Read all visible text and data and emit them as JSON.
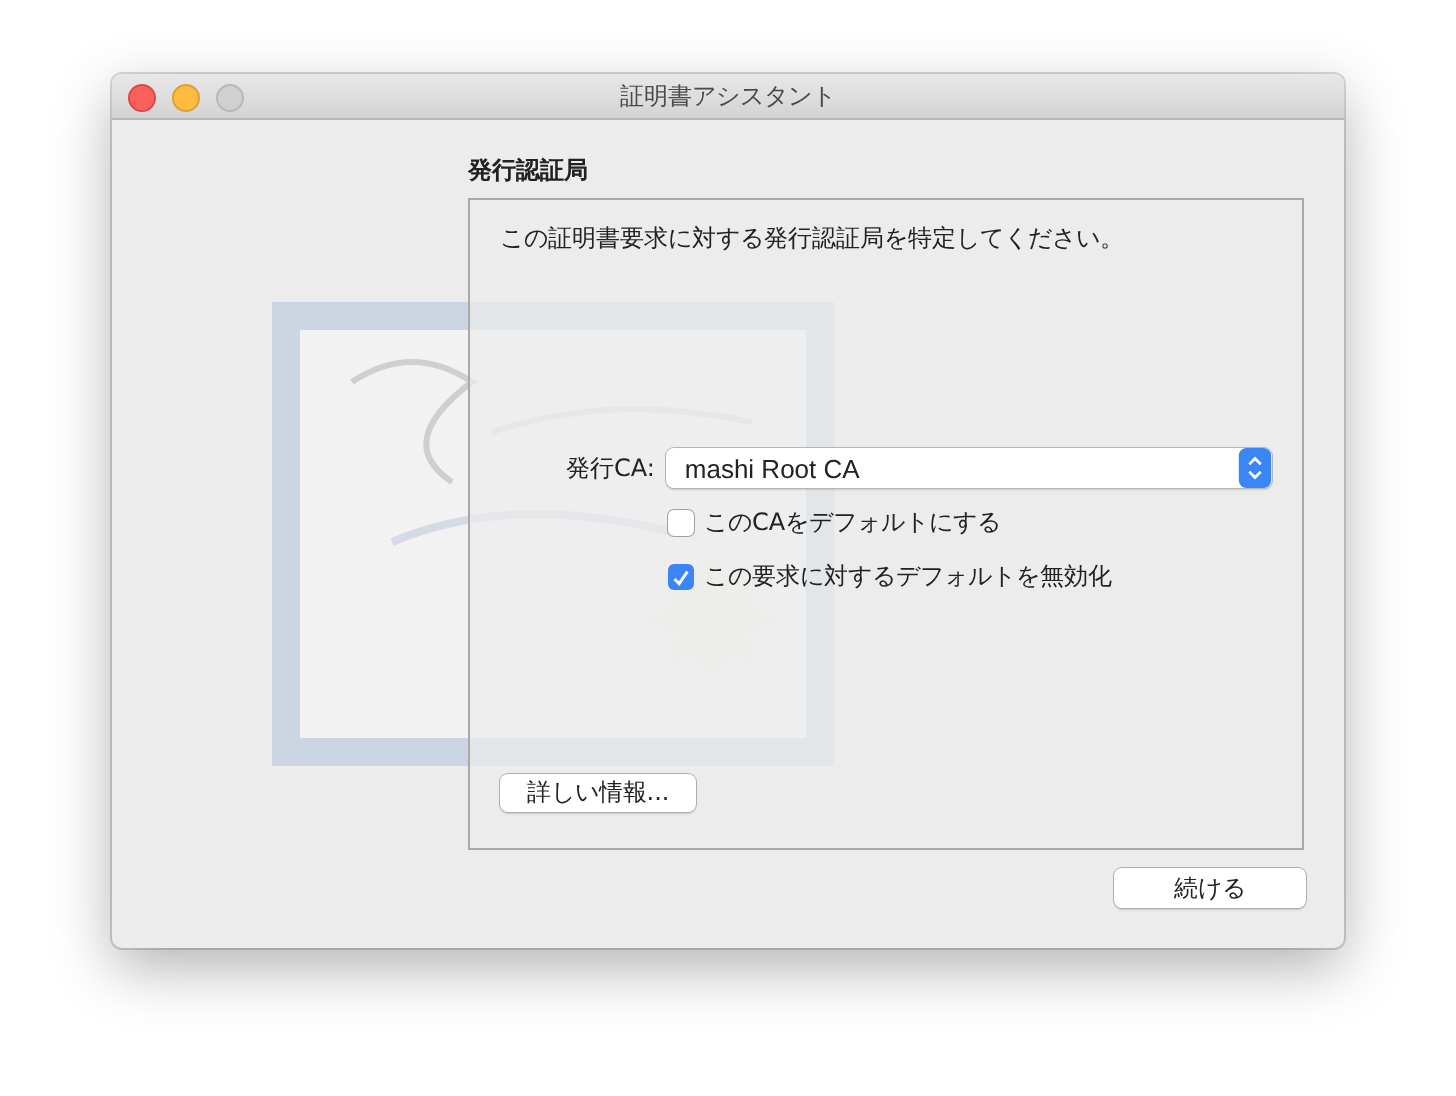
{
  "window": {
    "title": "証明書アシスタント"
  },
  "section": {
    "heading": "発行認証局",
    "description": "この証明書要求に対する発行認証局を特定してください。",
    "issuer": {
      "label": "発行CA:",
      "value": "mashi Root CA"
    },
    "checkboxes": [
      {
        "label": "このCAをデフォルトにする",
        "checked": false
      },
      {
        "label": "この要求に対するデフォルトを無効化",
        "checked": true
      }
    ],
    "details_button": "詳しい情報..."
  },
  "continue_button": "続ける"
}
